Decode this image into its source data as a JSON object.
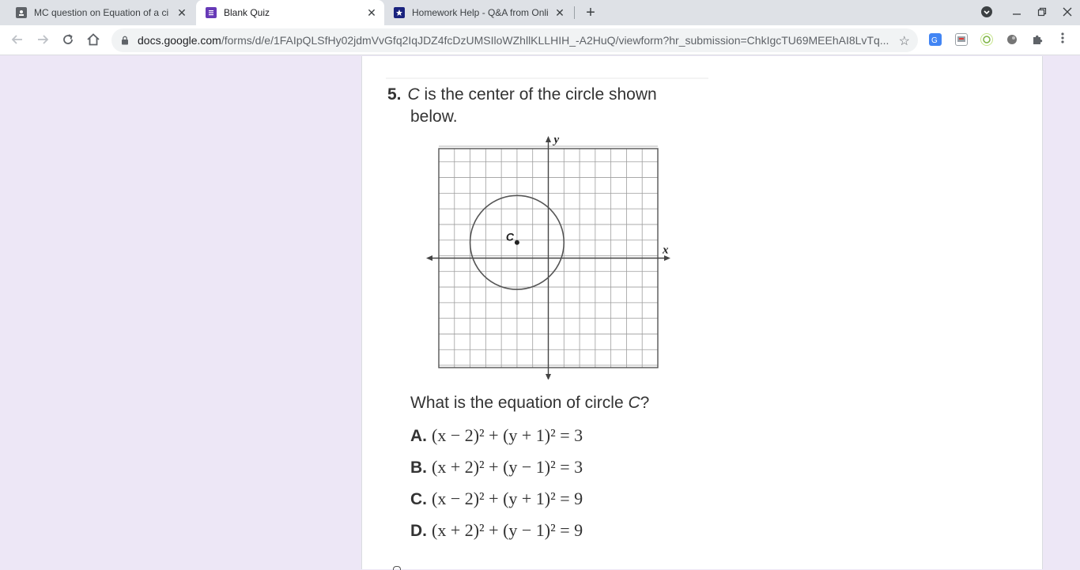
{
  "browser": {
    "tabs": [
      {
        "title": "MC question on Equation of a ci",
        "active": false,
        "favicon": "classroom-icon"
      },
      {
        "title": "Blank Quiz",
        "active": true,
        "favicon": "forms-icon"
      },
      {
        "title": "Homework Help - Q&A from Onli",
        "active": false,
        "favicon": "star-shield-icon"
      }
    ],
    "url_host": "docs.google.com",
    "url_path": "/forms/d/e/1FAIpQLSfHy02jdmVvGfq2IqJDZ4fcDzUMSIloWZhllKLLHIH_-A2HuQ/viewform?hr_submission=ChkIgcTU69MEEhAI8LvTq..."
  },
  "question": {
    "number": "5.",
    "text_var": "C",
    "text_line1": " is the center of the circle shown",
    "text_line2": "below.",
    "ask": "What is the equation of circle ",
    "ask_var": "C",
    "ask_end": "?",
    "graph": {
      "x_label": "x",
      "y_label": "y",
      "center_label": "C",
      "center": [
        -2,
        1
      ],
      "radius": 3,
      "grid_min": -7,
      "grid_max": 7
    },
    "choices": [
      {
        "letter": "A.",
        "text": "(x − 2)² + (y + 1)² = 3"
      },
      {
        "letter": "B.",
        "text": "(x + 2)² + (y − 1)² = 3"
      },
      {
        "letter": "C.",
        "text": "(x − 2)² + (y + 1)² = 9"
      },
      {
        "letter": "D.",
        "text": "(x + 2)² + (y − 1)² = 9"
      }
    ]
  },
  "colors": {
    "page_bg": "#ede7f6",
    "forms_purple": "#673ab7",
    "tab_strip": "#dee1e6"
  }
}
